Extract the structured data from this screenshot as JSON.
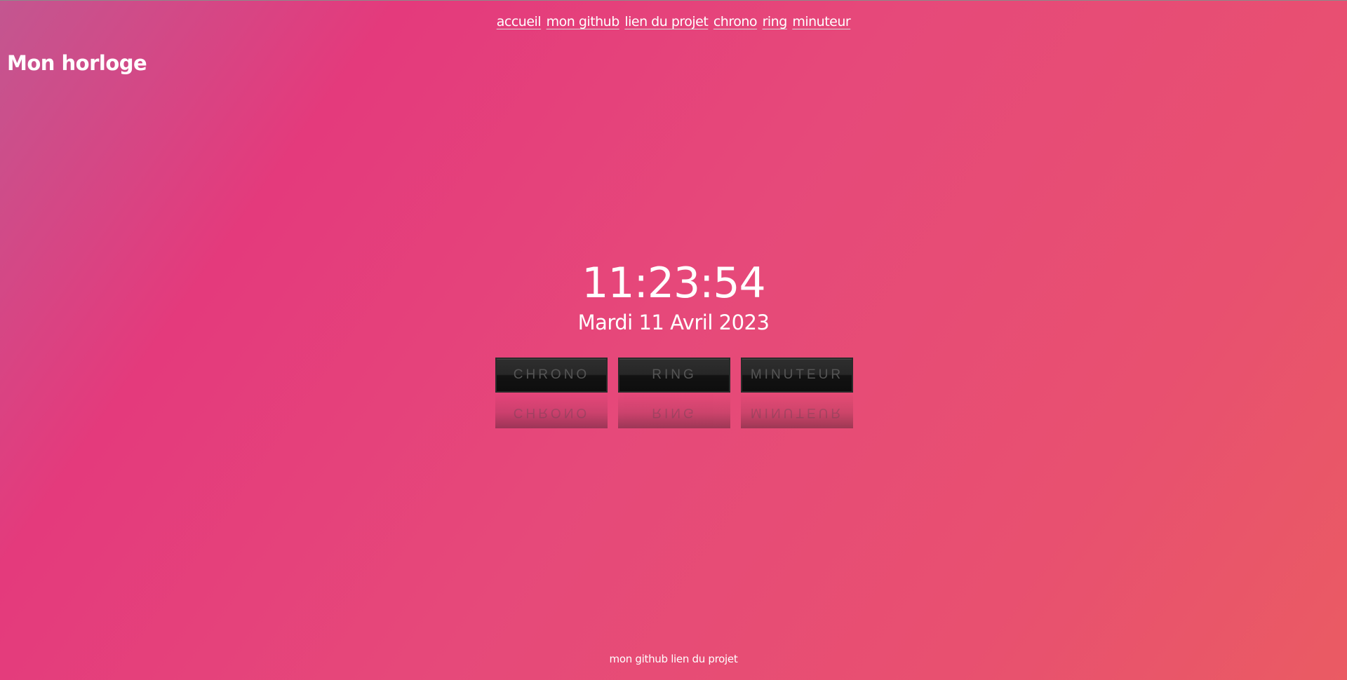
{
  "nav": {
    "links": [
      {
        "label": "accueil"
      },
      {
        "label": "mon github"
      },
      {
        "label": "lien du projet"
      },
      {
        "label": "chrono"
      },
      {
        "label": "ring"
      },
      {
        "label": "minuteur"
      }
    ]
  },
  "header": {
    "title": "Mon horloge"
  },
  "clock": {
    "time": "11:23:54",
    "date": "Mardi 11 Avril 2023"
  },
  "buttons": [
    {
      "label": "CHRONO"
    },
    {
      "label": "RING"
    },
    {
      "label": "MINUTEUR"
    }
  ],
  "footer": {
    "github_label": "mon github",
    "project_label": "lien du projet"
  },
  "colors": {
    "background_start": "#c35690",
    "background_mid": "#e43a7c",
    "background_end": "#ea5b63",
    "text": "#ffffff",
    "button_bg": "#1a1a1a",
    "button_text": "#555555"
  }
}
